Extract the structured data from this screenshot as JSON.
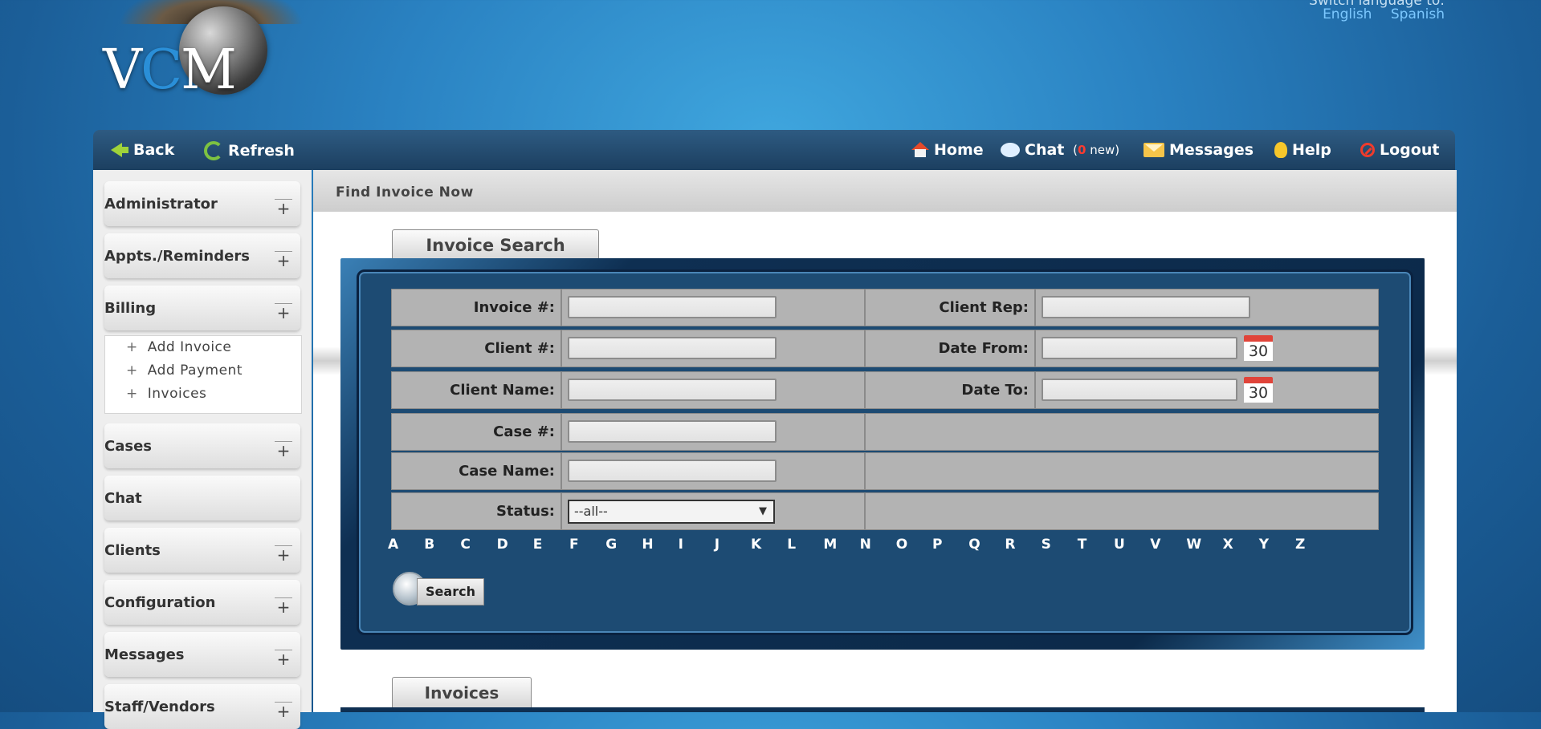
{
  "header": {
    "logo_text_v": "V",
    "logo_text_c": "C",
    "logo_text_m": "M",
    "language_label": "Switch language to:",
    "languages": [
      "English",
      "Spanish"
    ]
  },
  "toolbar": {
    "back": "Back",
    "refresh": "Refresh",
    "home": "Home",
    "chat": "Chat",
    "chat_new_count": "0",
    "chat_new_suffix": "new",
    "messages": "Messages",
    "help": "Help",
    "logout": "Logout"
  },
  "sidebar": {
    "items": [
      {
        "label": "Administrator",
        "has_plus": true
      },
      {
        "label": "Appts./Reminders",
        "has_plus": true
      },
      {
        "label": "Billing",
        "has_plus": true
      },
      {
        "label": "Cases",
        "has_plus": true
      },
      {
        "label": "Chat",
        "has_plus": false
      },
      {
        "label": "Clients",
        "has_plus": true
      },
      {
        "label": "Configuration",
        "has_plus": true
      },
      {
        "label": "Messages",
        "has_plus": true
      },
      {
        "label": "Staff/Vendors",
        "has_plus": true
      }
    ],
    "billing_sub": [
      "Add Invoice",
      "Add Payment",
      "Invoices"
    ],
    "plus_symbol": "+"
  },
  "main": {
    "page_title": "Find Invoice Now",
    "search_tab": "Invoice Search",
    "invoices_tab": "Invoices",
    "fields": {
      "invoice_no": "Invoice #:",
      "client_no": "Client #:",
      "client_name": "Client Name:",
      "case_no": "Case #:",
      "case_name": "Case Name:",
      "status": "Status:",
      "client_rep": "Client Rep:",
      "date_from": "Date From:",
      "date_to": "Date To:"
    },
    "status_value": "--all--",
    "calendar_day": "30",
    "alphabet": [
      "A",
      "B",
      "C",
      "D",
      "E",
      "F",
      "G",
      "H",
      "I",
      "J",
      "K",
      "L",
      "M",
      "N",
      "O",
      "P",
      "Q",
      "R",
      "S",
      "T",
      "U",
      "V",
      "W",
      "X",
      "Y",
      "Z"
    ],
    "search_button": "Search"
  }
}
